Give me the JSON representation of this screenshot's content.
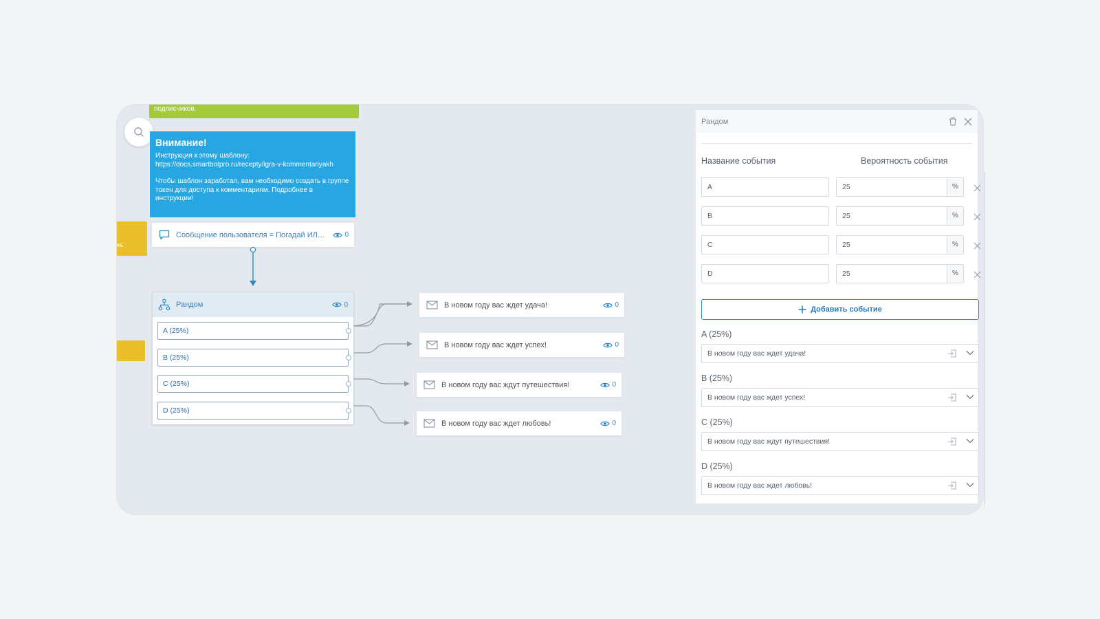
{
  "canvas": {
    "green_note_text": "подписчиков.",
    "blue_note": {
      "title": "Внимание!",
      "line1": "Инструкция к этому шаблону:",
      "link": "https://docs.smartbotpro.ru/recepty/igra-v-kommentariyakh",
      "body": "Чтобы шаблон заработал, вам необходимо создать в группе токен для доступа к комментариям. Подробнее в инструкции!"
    },
    "yellow_tab_label": "ке",
    "trigger_node": {
      "label": "Сообщение пользователя = Погадай ИЛИ ...",
      "views": "0"
    },
    "random_node": {
      "title": "Рандом",
      "views": "0",
      "options": [
        "A (25%)",
        "B (25%)",
        "C (25%)",
        "D (25%)"
      ]
    },
    "message_nodes": [
      {
        "label": "В новом году вас ждет удача!",
        "views": "0"
      },
      {
        "label": "В новом году вас ждет успех!",
        "views": "0"
      },
      {
        "label": "В новом году вас ждут путешествия!",
        "views": "0"
      },
      {
        "label": "В новом году вас ждет любовь!",
        "views": "0"
      }
    ]
  },
  "panel": {
    "title": "Рандом",
    "col_event_name": "Название события",
    "col_event_prob": "Вероятность события",
    "events": [
      {
        "name": "A",
        "prob": "25",
        "unit": "%"
      },
      {
        "name": "B",
        "prob": "25",
        "unit": "%"
      },
      {
        "name": "C",
        "prob": "25",
        "unit": "%"
      },
      {
        "name": "D",
        "prob": "25",
        "unit": "%"
      }
    ],
    "add_button": "Добавить событие",
    "branches": [
      {
        "label": "A (25%)",
        "value": "В новом году вас ждет удача!"
      },
      {
        "label": "B (25%)",
        "value": "В новом году вас ждет успех!"
      },
      {
        "label": "C (25%)",
        "value": "В новом году вас ждут путешествия!"
      },
      {
        "label": "D (25%)",
        "value": "В новом году вас ждет любовь!"
      }
    ]
  },
  "colors": {
    "accent": "#2e88c8",
    "note_blue": "#28a6e2",
    "note_green": "#a4c93a",
    "note_yellow": "#e9bf2b"
  }
}
